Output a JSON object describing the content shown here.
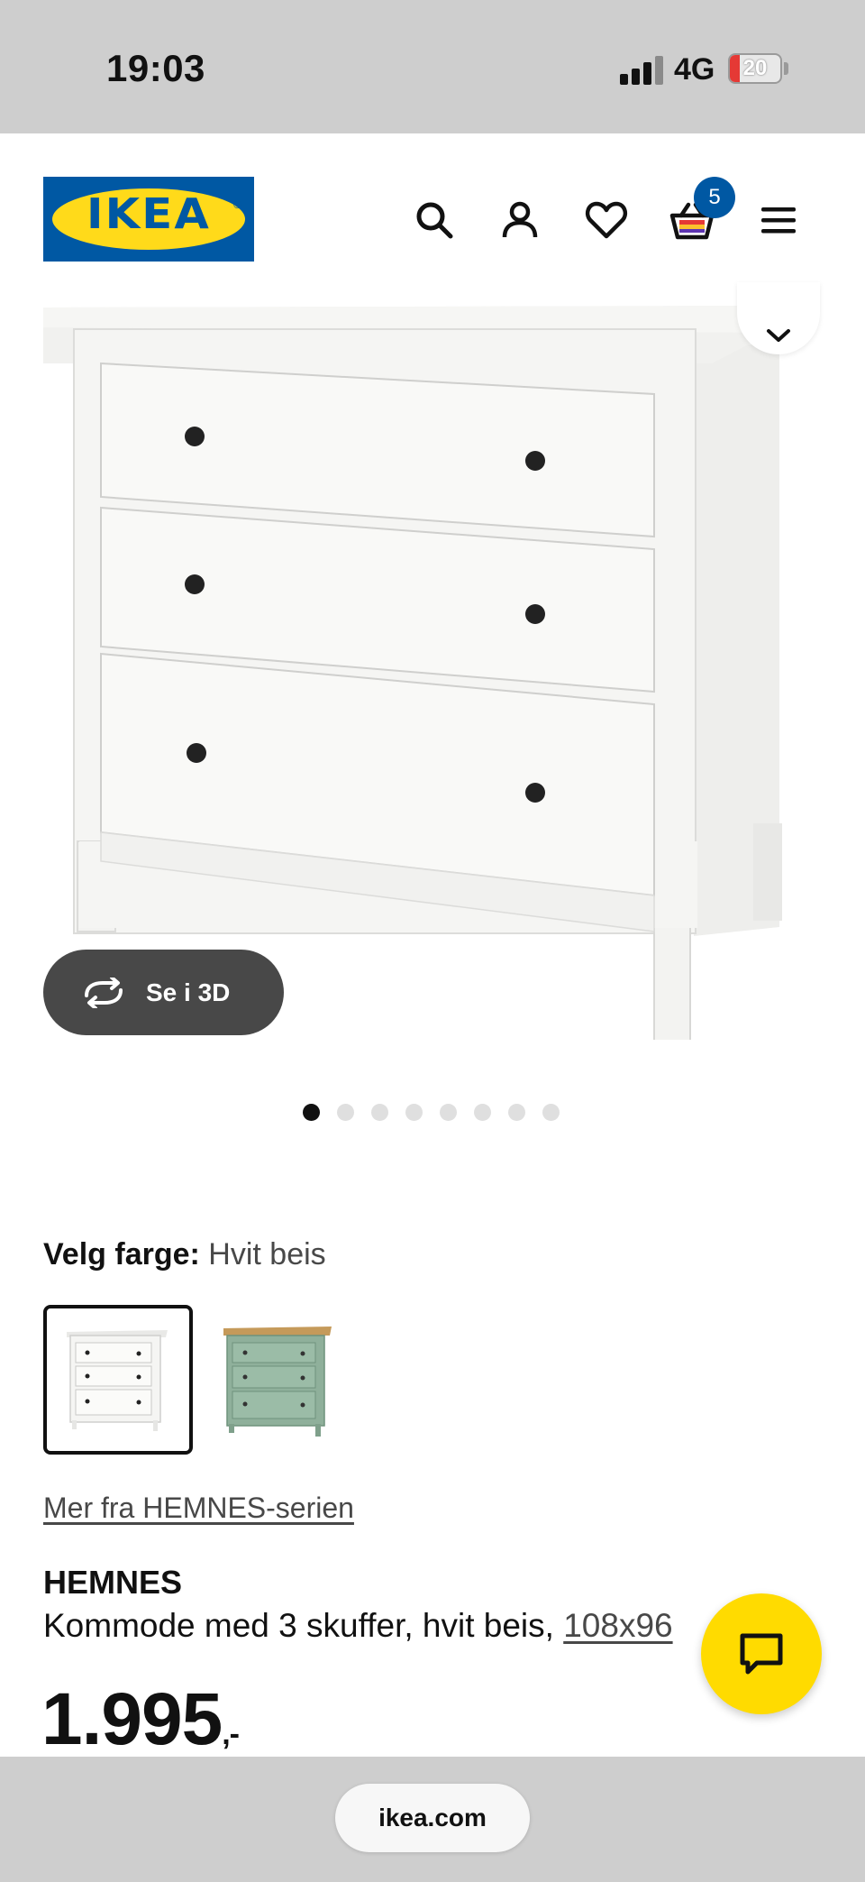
{
  "status_bar": {
    "time": "19:03",
    "network": "4G",
    "battery_level": "20"
  },
  "header": {
    "logo_text": "IKEA",
    "cart_count": "5",
    "icons": [
      "search-icon",
      "profile-icon",
      "heart-icon",
      "cart-icon",
      "menu-icon"
    ]
  },
  "gallery": {
    "view_3d_label": "Se i 3D",
    "image_count": 8,
    "active_index": 0
  },
  "color_selector": {
    "label": "Velg farge:",
    "value": "Hvit beis",
    "options": [
      {
        "name": "Hvit beis",
        "selected": true,
        "color": "#f4f3ef"
      },
      {
        "name": "Grønn",
        "selected": false,
        "color": "#8fb09b"
      }
    ]
  },
  "series_link": "Mer fra HEMNES-serien",
  "product": {
    "name": "HEMNES",
    "description": "Kommode med 3 skuffer, hvit beis,",
    "dimensions": "108x96",
    "price": "1.995",
    "price_suffix": ",-"
  },
  "browser": {
    "url": "ikea.com"
  },
  "colors": {
    "ikea_blue": "#0058a3",
    "ikea_yellow": "#ffda1a",
    "chat_yellow": "#ffdb00"
  }
}
